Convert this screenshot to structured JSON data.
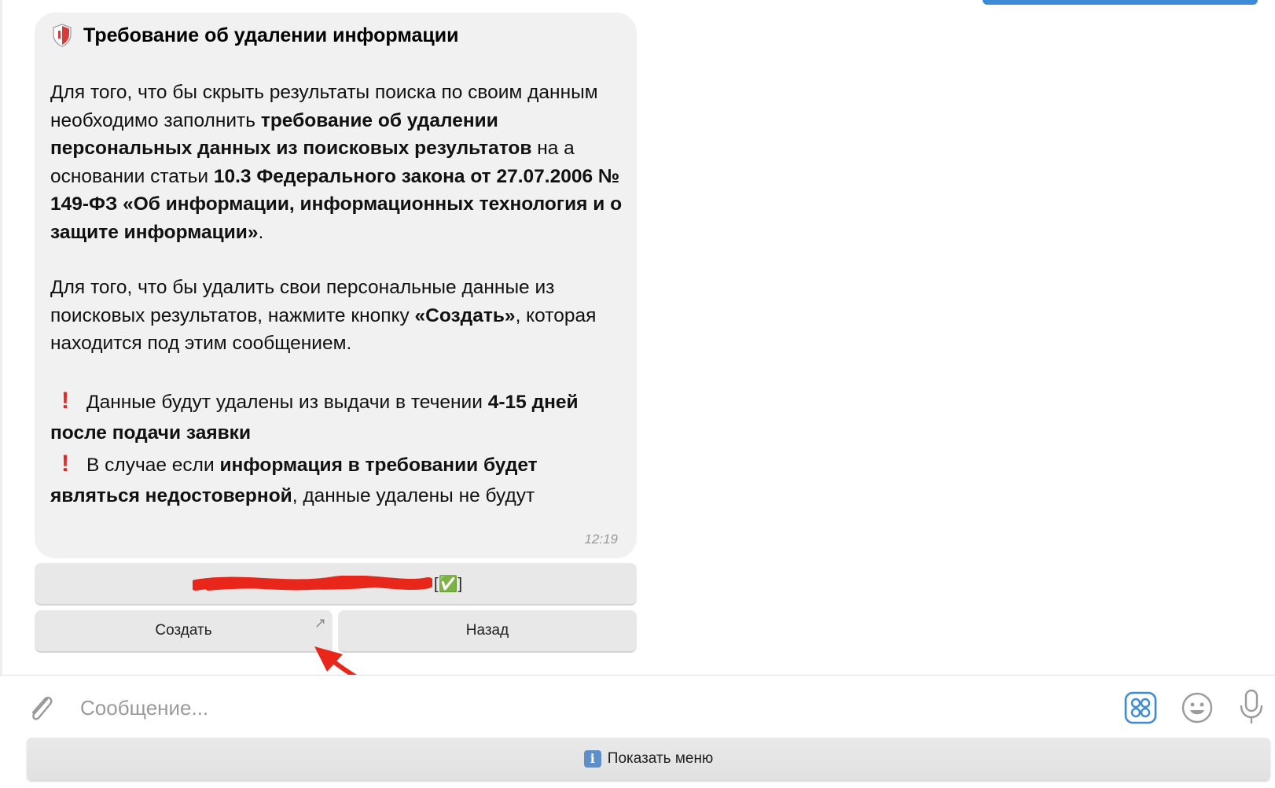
{
  "message": {
    "title": "Требование об удалении информации",
    "p1": [
      {
        "t": "Для того, что бы скрыть результаты поиска по своим данным необходимо заполнить ",
        "b": false
      },
      {
        "t": "требование об удалении персональных данных из поисковых результатов",
        "b": true
      },
      {
        "t": " на а основании статьи ",
        "b": false
      },
      {
        "t": "10.3 Федерального закона от 27.07.2006 № 149-ФЗ «Об информации, информационных технология и о защите информации»",
        "b": true
      },
      {
        "t": ".",
        "b": false
      }
    ],
    "p2": [
      {
        "t": "Для того, что бы удалить свои персональные данные из поисковых результатов, нажмите кнопку ",
        "b": false
      },
      {
        "t": "«Создать»",
        "b": true
      },
      {
        "t": ", которая находится под этим сообщением.",
        "b": false
      }
    ],
    "warning1": [
      {
        "t": "Данные будут удалены из выдачи в течении ",
        "b": false
      },
      {
        "t": "4-15 дней после подачи заявки",
        "b": true
      }
    ],
    "warning2": [
      {
        "t": "В случае если ",
        "b": false
      },
      {
        "t": "информация в требовании будет являться недостоверной",
        "b": true
      },
      {
        "t": ", данные удалены не будут",
        "b": false
      }
    ],
    "exclaim_glyph": "!",
    "time": "12:19"
  },
  "keyboard": {
    "top_suffix": "[✅]",
    "create_label": "Создать",
    "back_label": "Назад",
    "ext_arrow": "↗"
  },
  "input": {
    "placeholder": "Сообщение..."
  },
  "menu_bar": {
    "info_glyph": "i",
    "label": "Показать меню"
  },
  "colors": {
    "accent": "#3d8bd6",
    "annotation": "#e8261a",
    "exclaim": "#e02a2a"
  }
}
